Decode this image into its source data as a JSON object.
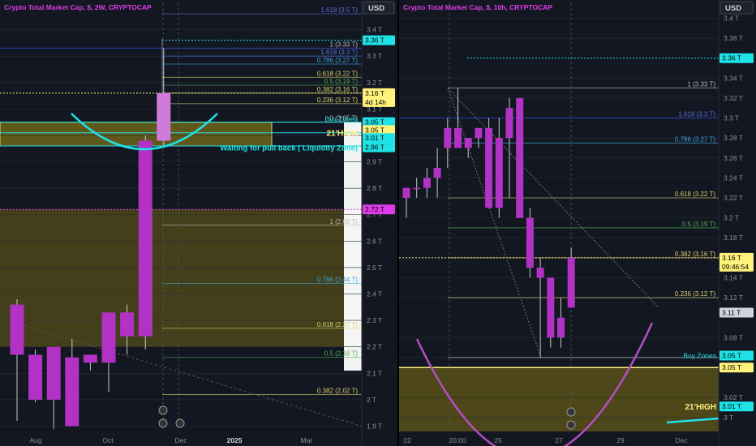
{
  "colors": {
    "bg": "#131722",
    "candle": "#b132c4",
    "candle_light": "#d07ad9",
    "grid": "#2a2e39",
    "yellow_line": "#c8c04a",
    "zone_fill": "#5d5418",
    "cyan": "#1fe3e6",
    "magenta": "#e03ce8",
    "blue_line": "#2a3fa8",
    "green_fib": "#4caf50",
    "axis_text": "#8a8f99"
  },
  "chart_data": [
    {
      "type": "candlestick",
      "title": "Crypto Total Market Cap, $, 2W, CRYPTOCAP",
      "axis_currency": "USD",
      "ylim": [
        1.88,
        3.5
      ],
      "y_ticks": [
        "3.4 T",
        "3.3 T",
        "3.2 T",
        "3.1 T",
        "3 T",
        "2.9 T",
        "2.8 T",
        "2.7 T",
        "2.6 T",
        "2.5 T",
        "2.4 T",
        "2.3 T",
        "2.2 T",
        "2.1 T",
        "2 T",
        "1.9 T"
      ],
      "y_tick_values": [
        3.4,
        3.3,
        3.2,
        3.1,
        3.0,
        2.9,
        2.8,
        2.7,
        2.6,
        2.5,
        2.4,
        2.3,
        2.2,
        2.1,
        2.0,
        1.9
      ],
      "x_labels": [
        "Aug",
        "Oct",
        "Dec",
        "2025",
        "Mar"
      ],
      "candles": [
        {
          "o": 2.36,
          "h": 2.38,
          "l": 1.92,
          "c": 2.17
        },
        {
          "o": 2.17,
          "h": 2.19,
          "l": 1.99,
          "c": 2.0
        },
        {
          "o": 2.0,
          "h": 2.2,
          "l": 1.89,
          "c": 2.2
        },
        {
          "o": 2.16,
          "h": 2.23,
          "l": 1.9,
          "c": 1.9
        },
        {
          "o": 2.14,
          "h": 2.16,
          "l": 2.11,
          "c": 2.17
        },
        {
          "o": 2.14,
          "h": 2.21,
          "l": 2.03,
          "c": 2.33
        },
        {
          "o": 2.24,
          "h": 2.36,
          "l": 2.17,
          "c": 2.33
        },
        {
          "o": 2.24,
          "h": 3.0,
          "l": 2.19,
          "c": 2.98
        },
        {
          "o": 2.98,
          "h": 3.33,
          "l": 2.96,
          "c": 3.16
        }
      ],
      "fib_levels": [
        {
          "label": "1.618 (3.5 T)",
          "value": 3.46,
          "color": "#5a6cd6"
        },
        {
          "label": "1 (3.33 T)",
          "value": 3.33,
          "color": "#bbbbbb"
        },
        {
          "label": "1.618 (3.3 T)",
          "value": 3.3,
          "color": "#5a6cd6"
        },
        {
          "label": "0.786 (3.27 T)",
          "value": 3.27,
          "color": "#3aa7d8"
        },
        {
          "label": "0.618 (3.22 T)",
          "value": 3.22,
          "color": "#d9d36a"
        },
        {
          "label": "0.5 (3.19 T)",
          "value": 3.19,
          "color": "#4caf50"
        },
        {
          "label": "0.382 (3.16 T)",
          "value": 3.16,
          "color": "#d9d36a"
        },
        {
          "label": "0.236 (3.12 T)",
          "value": 3.12,
          "color": "#d9d36a"
        },
        {
          "label": "0 (3.05 T)",
          "value": 3.05,
          "color": "#bbbbbb"
        },
        {
          "label": "1 (2.66 T)",
          "value": 2.66,
          "color": "#bbbbbb"
        },
        {
          "label": "0.786 (2.44 T)",
          "value": 2.44,
          "color": "#3aa7d8"
        },
        {
          "label": "0.618 (2.27 T)",
          "value": 2.27,
          "color": "#d9d36a"
        },
        {
          "label": "0.5 (2.16 T)",
          "value": 2.16,
          "color": "#4caf50"
        },
        {
          "label": "0.382 (2.02 T)",
          "value": 2.02,
          "color": "#d9d36a"
        }
      ],
      "price_tags": [
        {
          "text": "3.36 T",
          "value": 3.36,
          "bg": "#1fe3e6",
          "fg": "#000"
        },
        {
          "text": "3.16 T\n4d 14h",
          "value": 3.16,
          "bg": "#fff27a",
          "fg": "#000"
        },
        {
          "text": "3.05 T",
          "value": 3.05,
          "bg": "#1fe3e6",
          "fg": "#000"
        },
        {
          "text": "3.05 T",
          "value": 3.02,
          "bg": "#fff27a",
          "fg": "#000"
        },
        {
          "text": "3.01 T",
          "value": 2.99,
          "bg": "#1fe3e6",
          "fg": "#000"
        },
        {
          "text": "2.96 T",
          "value": 2.955,
          "bg": "#1fe3e6",
          "fg": "#000"
        },
        {
          "text": "2.72 T",
          "value": 2.72,
          "bg": "#e03ce8",
          "fg": "#000"
        }
      ],
      "annotations": {
        "buy_zones": "Buy Zones",
        "high_label": "21'HIGH",
        "pullback": "Waiting for pull back ( Liquidity Zone)"
      }
    },
    {
      "type": "candlestick",
      "title": "Crypto Total Market Cap, $, 10h, CRYPTOCAP",
      "axis_currency": "USD",
      "ylim": [
        2.986,
        3.415
      ],
      "y_ticks": [
        "3.4 T",
        "3.38 T",
        "3.34 T",
        "3.32 T",
        "3.3 T",
        "3.28 T",
        "3.26 T",
        "3.24 T",
        "3.22 T",
        "3.2 T",
        "3.18 T",
        "3.14 T",
        "3.12 T",
        "3.08 T",
        "3.06 T",
        "3.02 T",
        "3 T"
      ],
      "y_tick_values": [
        3.4,
        3.38,
        3.34,
        3.32,
        3.3,
        3.28,
        3.26,
        3.24,
        3.22,
        3.2,
        3.18,
        3.14,
        3.12,
        3.08,
        3.06,
        3.02,
        3.0
      ],
      "x_labels": [
        "22",
        "20:00",
        "25",
        "27",
        "29",
        "Dec"
      ],
      "candles": [
        {
          "o": 3.22,
          "h": 3.23,
          "l": 3.2,
          "c": 3.23
        },
        {
          "o": 3.23,
          "h": 3.24,
          "l": 3.22,
          "c": 3.23
        },
        {
          "o": 3.23,
          "h": 3.25,
          "l": 3.22,
          "c": 3.24
        },
        {
          "o": 3.24,
          "h": 3.27,
          "l": 3.22,
          "c": 3.25
        },
        {
          "o": 3.27,
          "h": 3.3,
          "l": 3.25,
          "c": 3.29
        },
        {
          "o": 3.29,
          "h": 3.33,
          "l": 3.27,
          "c": 3.27
        },
        {
          "o": 3.27,
          "h": 3.28,
          "l": 3.26,
          "c": 3.28
        },
        {
          "o": 3.28,
          "h": 3.29,
          "l": 3.27,
          "c": 3.29
        },
        {
          "o": 3.29,
          "h": 3.3,
          "l": 3.21,
          "c": 3.21
        },
        {
          "o": 3.21,
          "h": 3.3,
          "l": 3.2,
          "c": 3.28
        },
        {
          "o": 3.28,
          "h": 3.32,
          "l": 3.22,
          "c": 3.31
        },
        {
          "o": 3.32,
          "h": 3.32,
          "l": 3.2,
          "c": 3.2
        },
        {
          "o": 3.2,
          "h": 3.21,
          "l": 3.14,
          "c": 3.15
        },
        {
          "o": 3.15,
          "h": 3.16,
          "l": 3.06,
          "c": 3.14
        },
        {
          "o": 3.14,
          "h": 3.14,
          "l": 3.07,
          "c": 3.08
        },
        {
          "o": 3.08,
          "h": 3.12,
          "l": 3.07,
          "c": 3.1
        },
        {
          "o": 3.11,
          "h": 3.17,
          "l": 3.11,
          "c": 3.16
        }
      ],
      "fib_levels": [
        {
          "label": "1 (3.33 T)",
          "value": 3.33,
          "color": "#bbbbbb"
        },
        {
          "label": "1.618 (3.3 T)",
          "value": 3.3,
          "color": "#5a6cd6"
        },
        {
          "label": "0.786 (3.27 T)",
          "value": 3.275,
          "color": "#3aa7d8"
        },
        {
          "label": "0.618 (3.22 T)",
          "value": 3.22,
          "color": "#d9d36a"
        },
        {
          "label": "0.5 (3.19 T)",
          "value": 3.19,
          "color": "#4caf50"
        },
        {
          "label": "0.382 (3.16 T)",
          "value": 3.16,
          "color": "#d9d36a"
        },
        {
          "label": "0.236 (3.12 T)",
          "value": 3.12,
          "color": "#d9d36a"
        }
      ],
      "price_tags": [
        {
          "text": "3.36 T",
          "value": 3.36,
          "bg": "#1fe3e6",
          "fg": "#000"
        },
        {
          "text": "3.16 T\n09:46:54",
          "value": 3.16,
          "bg": "#fff27a",
          "fg": "#000"
        },
        {
          "text": "3.11 T",
          "value": 3.105,
          "bg": "#d1d4dc",
          "fg": "#000"
        },
        {
          "text": "3.05 T",
          "value": 3.062,
          "bg": "#1fe3e6",
          "fg": "#000"
        },
        {
          "text": "3.05 T",
          "value": 3.05,
          "bg": "#fff27a",
          "fg": "#000"
        },
        {
          "text": "3.01 T",
          "value": 3.011,
          "bg": "#1fe3e6",
          "fg": "#000"
        }
      ],
      "annotations": {
        "buy_zones": "Buy Zones",
        "high_label": "21'HIGH"
      }
    }
  ]
}
